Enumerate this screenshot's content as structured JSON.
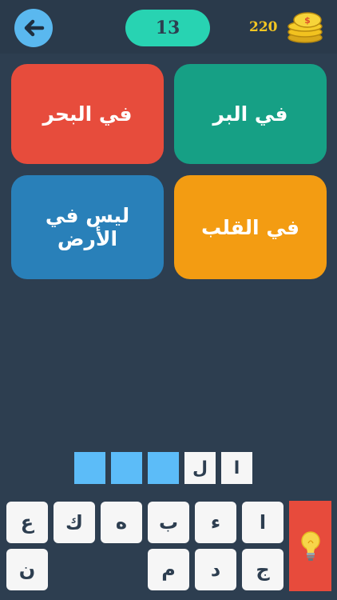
{
  "header": {
    "level": "13",
    "coins": "220"
  },
  "choices": [
    {
      "label": "في البحر",
      "color": "#e74c3c"
    },
    {
      "label": "في البر",
      "color": "#16a085"
    },
    {
      "label": "ليس في الأرض",
      "color": "#2980b9"
    },
    {
      "label": "في القلب",
      "color": "#f39c12"
    }
  ],
  "answer": {
    "slots": [
      "",
      "",
      "",
      "ل",
      "ا"
    ]
  },
  "keyboard": {
    "row1": [
      "ع",
      "ك",
      "ه",
      "ب",
      "ء",
      "ا"
    ],
    "row2": [
      "ن",
      "",
      "",
      "م",
      "د",
      "ج"
    ]
  },
  "colors": {
    "background": "#2d3e50",
    "accent_level": "#28d3b2",
    "coin": "#f3c623",
    "hint": "#e74b3c"
  }
}
